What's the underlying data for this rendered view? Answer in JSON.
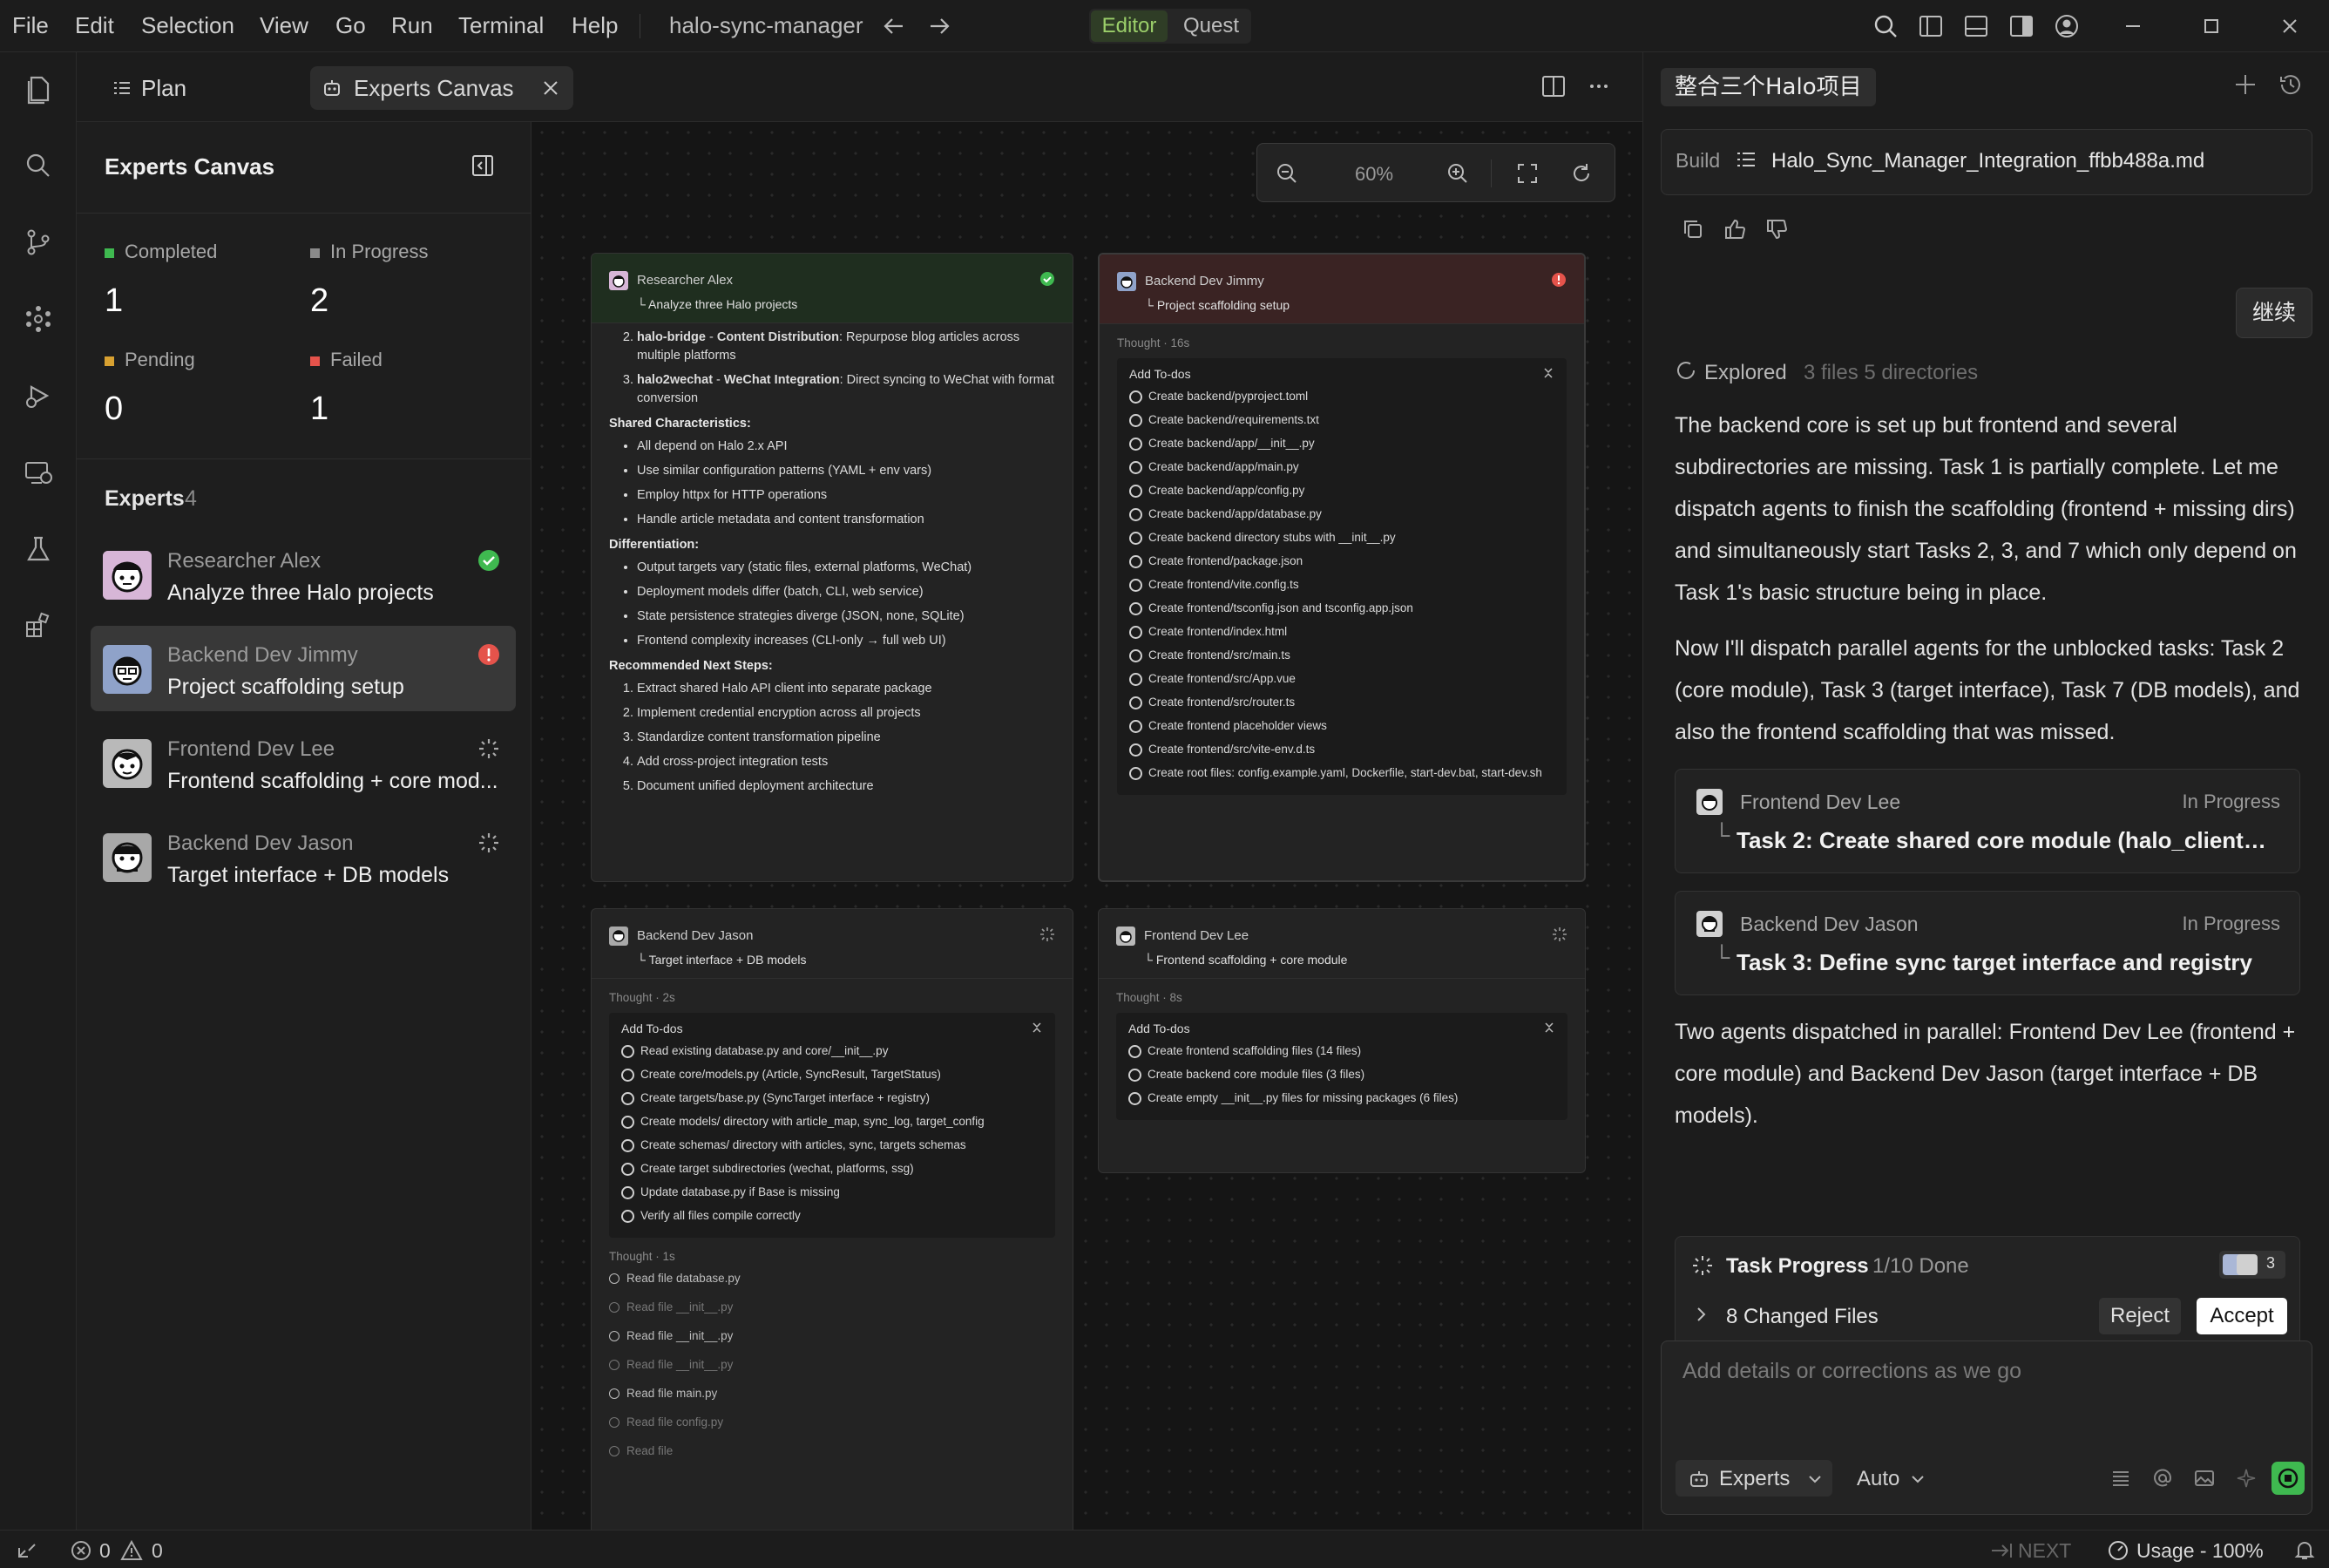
{
  "menubar": {
    "items": [
      "File",
      "Edit",
      "Selection",
      "View",
      "Go",
      "Run",
      "Terminal",
      "Help"
    ],
    "project": "halo-sync-manager",
    "mode_editor": "Editor",
    "mode_quest": "Quest"
  },
  "tabs": {
    "plan": "Plan",
    "experts_canvas": "Experts Canvas"
  },
  "left_panel": {
    "title": "Experts Canvas",
    "stats": {
      "completed_label": "Completed",
      "completed_value": "1",
      "in_progress_label": "In Progress",
      "in_progress_value": "2",
      "pending_label": "Pending",
      "pending_value": "0",
      "failed_label": "Failed",
      "failed_value": "1"
    },
    "experts_label": "Experts",
    "experts_count": "4",
    "experts": [
      {
        "name": "Researcher Alex",
        "task": "Analyze three Halo projects",
        "status": "completed"
      },
      {
        "name": "Backend Dev Jimmy",
        "task": "Project scaffolding setup",
        "status": "failed"
      },
      {
        "name": "Frontend Dev Lee",
        "task": "Frontend scaffolding + core mod...",
        "status": "in-progress"
      },
      {
        "name": "Backend Dev Jason",
        "task": "Target interface + DB models",
        "status": "in-progress"
      }
    ]
  },
  "zoom": {
    "level": "60%"
  },
  "cards": {
    "alex": {
      "name": "Researcher Alex",
      "task": "Analyze three Halo projects",
      "list_top": [
        {
          "bold": "halo-bridge",
          "sep": " - ",
          "bold2": "Content Distribution",
          "rest": ": Repurpose blog articles across multiple platforms"
        },
        {
          "bold": "halo2wechat",
          "sep": " - ",
          "bold2": "WeChat Integration",
          "rest": ": Direct syncing to WeChat with format conversion"
        }
      ],
      "shared_title": "Shared Characteristics:",
      "shared": [
        "All depend on Halo 2.x API",
        "Use similar configuration patterns (YAML + env vars)",
        "Employ httpx for HTTP operations",
        "Handle article metadata and content transformation"
      ],
      "diff_title": "Differentiation:",
      "diff": [
        "Output targets vary (static files, external platforms, WeChat)",
        "Deployment models differ (batch, CLI, web service)",
        "State persistence strategies diverge (JSON, none, SQLite)",
        "Frontend complexity increases (CLI-only → full web UI)"
      ],
      "next_title": "Recommended Next Steps:",
      "next": [
        "Extract shared Halo API client into separate package",
        "Implement credential encryption across all projects",
        "Standardize content transformation pipeline",
        "Add cross-project integration tests",
        "Document unified deployment architecture"
      ]
    },
    "jimmy": {
      "name": "Backend Dev Jimmy",
      "task": "Project scaffolding setup",
      "thought": "Thought · 16s",
      "todo_title": "Add To-dos",
      "todos": [
        "Create backend/pyproject.toml",
        "Create backend/requirements.txt",
        "Create backend/app/__init__.py",
        "Create backend/app/main.py",
        "Create backend/app/config.py",
        "Create backend/app/database.py",
        "Create backend directory stubs with __init__.py",
        "Create frontend/package.json",
        "Create frontend/vite.config.ts",
        "Create frontend/tsconfig.json and tsconfig.app.json",
        "Create frontend/index.html",
        "Create frontend/src/main.ts",
        "Create frontend/src/App.vue",
        "Create frontend/src/router.ts",
        "Create frontend placeholder views",
        "Create frontend/src/vite-env.d.ts",
        "Create root files: config.example.yaml, Dockerfile, start-dev.bat, start-dev.sh"
      ]
    },
    "jason": {
      "name": "Backend Dev Jason",
      "task": "Target interface + DB models",
      "thought": "Thought · 2s",
      "todo_title": "Add To-dos",
      "todos": [
        "Read existing database.py and core/__init__.py",
        "Create core/models.py (Article, SyncResult, TargetStatus)",
        "Create targets/base.py (SyncTarget interface + registry)",
        "Create models/ directory with article_map, sync_log, target_config",
        "Create schemas/ directory with articles, sync, targets schemas",
        "Create target subdirectories (wechat, platforms, ssg)",
        "Update database.py if Base is missing",
        "Verify all files compile correctly"
      ],
      "thought2": "Thought · 1s",
      "reads": [
        "Read file database.py",
        "Read file __init__.py",
        "Read file __init__.py",
        "Read file __init__.py",
        "Read file main.py",
        "Read file config.py",
        "Read file"
      ]
    },
    "lee": {
      "name": "Frontend Dev Lee",
      "task": "Frontend scaffolding + core module",
      "thought": "Thought · 8s",
      "todo_title": "Add To-dos",
      "todos": [
        "Create frontend scaffolding files (14 files)",
        "Create backend core module files (3 files)",
        "Create empty __init__.py files for missing packages (6 files)"
      ]
    }
  },
  "right_panel": {
    "title": "整合三个Halo项目",
    "build_label": "Build",
    "build_file": "Halo_Sync_Manager_Integration_ffbb488a.md",
    "continue_label": "继续",
    "explored_label": "Explored",
    "explored_detail": "3 files 5 directories",
    "para1": "The backend core is set up but frontend and several subdirectories are missing. Task 1 is partially complete. Let me dispatch agents to finish the scaffolding (frontend + missing dirs) and simultaneously start Tasks 2, 3, and 7 which only depend on Task 1's basic structure being in place.",
    "para2": "Now I'll dispatch parallel agents for the unblocked tasks: Task 2 (core module), Task 3 (target interface), Task 7 (DB models), and also the frontend scaffolding that was missed.",
    "task_cards": [
      {
        "name": "Frontend Dev Lee",
        "status": "In Progress",
        "task": "Task 2: Create shared core module (halo_client, mo..."
      },
      {
        "name": "Backend Dev Jason",
        "status": "In Progress",
        "task": "Task 3: Define sync target interface and registry"
      }
    ],
    "para3": "Two agents dispatched in parallel: Frontend Dev Lee (frontend + core module) and Backend Dev Jason (target interface + DB models).",
    "progress_label": "Task Progress",
    "progress_value": "1/10 Done",
    "avatars_count": "3",
    "changed_files": "8 Changed Files",
    "reject_label": "Reject",
    "accept_label": "Accept",
    "input_placeholder": "Add details or corrections as we go",
    "experts_btn": "Experts",
    "auto_btn": "Auto"
  },
  "statusbar": {
    "errors": "0",
    "warnings": "0",
    "next_label": "NEXT",
    "usage": "Usage - 100%"
  },
  "colors": {
    "completed": "#3fb950",
    "in_progress": "#8a8a8a",
    "pending": "#d8a131",
    "failed": "#e5534b",
    "alex_header": "#1f2e1f",
    "jimmy_header": "#3a2323"
  }
}
